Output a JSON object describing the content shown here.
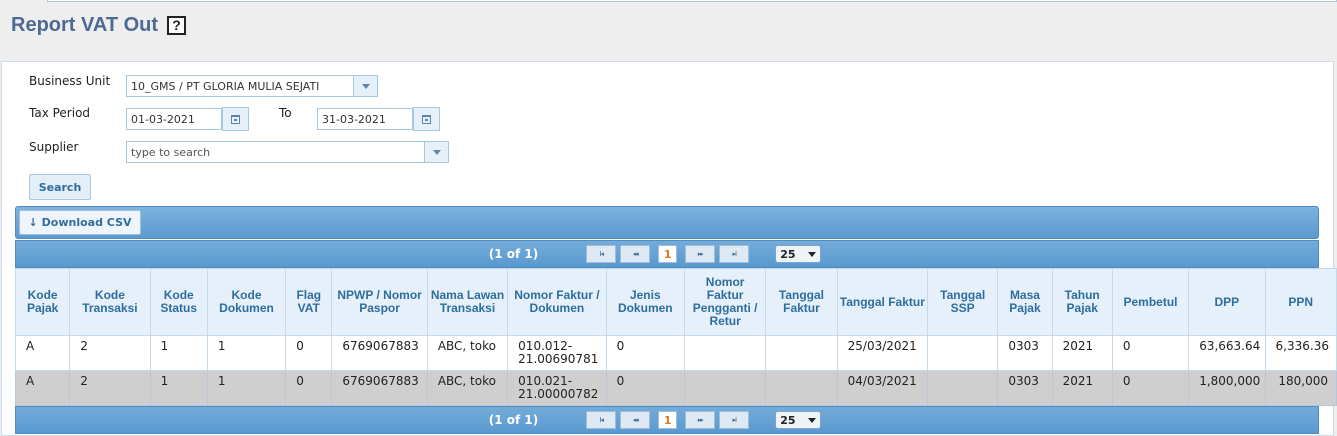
{
  "page": {
    "title": "Report VAT Out",
    "help_glyph": "?"
  },
  "form": {
    "business_unit_label": "Business Unit",
    "business_unit_value": "10_GMS / PT GLORIA MULIA SEJATI",
    "tax_period_label": "Tax Period",
    "tax_period_from": "01-03-2021",
    "to_label": "To",
    "tax_period_to": "31-03-2021",
    "supplier_label": "Supplier",
    "supplier_placeholder": "type to search",
    "search_label": "Search"
  },
  "toolbar": {
    "download_csv_label": "Download CSV",
    "download_icon": "↓"
  },
  "pager": {
    "count": "(1 of 1)",
    "first": "I◂",
    "prev": "◂◂",
    "page": "1",
    "next": "▸▸",
    "last": "▸I",
    "page_size": "25"
  },
  "table": {
    "columns": [
      "Kode Pajak",
      "Kode Transaksi",
      "Kode Status",
      "Kode Dokumen",
      "Flag VAT",
      "NPWP / Nomor Paspor",
      "Nama Lawan Transaksi",
      "Nomor Faktur / Dokumen",
      "Jenis Dokumen",
      "Nomor Faktur Pengganti / Retur",
      "Tanggal Faktur",
      "Tanggal Faktur",
      "Tanggal SSP",
      "Masa Pajak",
      "Tahun Pajak",
      "Pembetul",
      "DPP",
      "PPN"
    ],
    "rows": [
      [
        "A",
        "2",
        "1",
        "1",
        "0",
        "6769067883",
        "ABC, toko",
        "010.012-21.00690781",
        "0",
        "",
        "",
        "25/03/2021",
        "",
        "0303",
        "2021",
        "0",
        "63,663.64",
        "6,336.36"
      ],
      [
        "A",
        "2",
        "1",
        "1",
        "0",
        "6769067883",
        "ABC, toko",
        "010.021-21.00000782",
        "0",
        "",
        "",
        "04/03/2021",
        "",
        "0303",
        "2021",
        "0",
        "1,800,000",
        "180,000"
      ]
    ]
  },
  "colors": {
    "title": "#4c6a93",
    "header_bar": "#5a9ad0",
    "column_header_text": "#2e6e9e",
    "selected_row": "#cfcfcf"
  }
}
